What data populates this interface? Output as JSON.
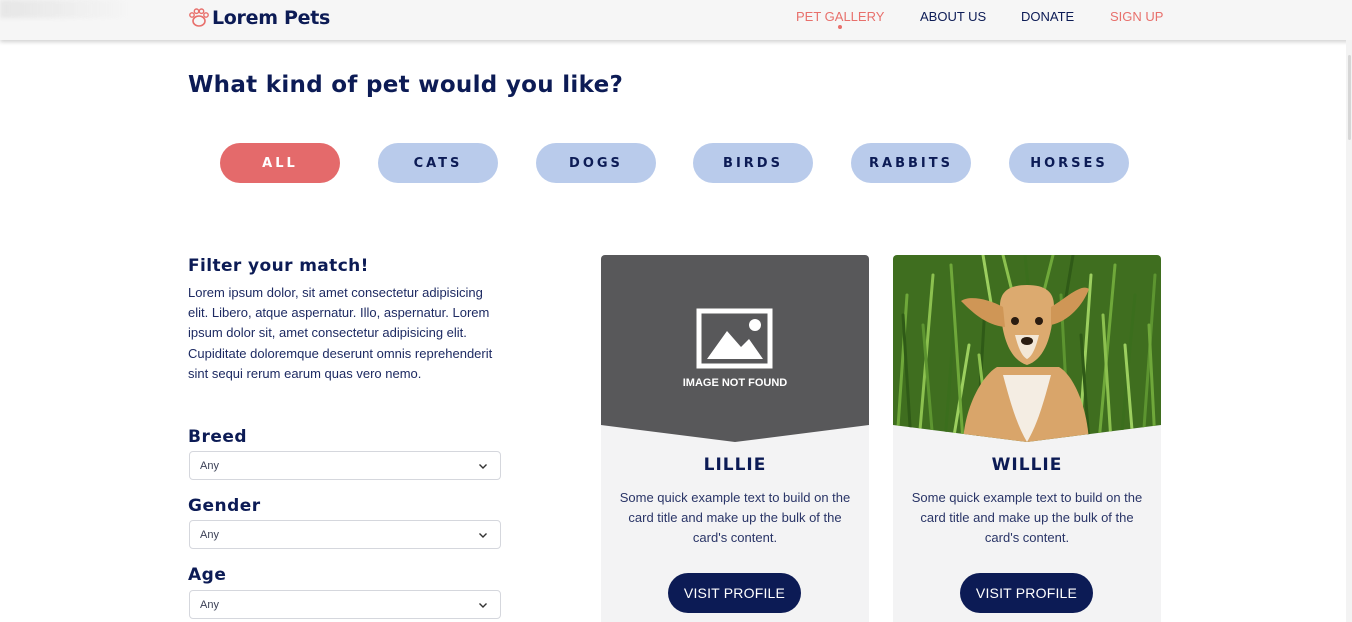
{
  "brand": {
    "name": "Lorem Pets",
    "icon": "paw-icon"
  },
  "nav": {
    "gallery": "PET GALLERY",
    "about": "ABOUT US",
    "donate": "DONATE",
    "signup": "SIGN UP"
  },
  "heading": "What kind of pet would you like?",
  "categories": [
    {
      "label": "ALL",
      "active": true
    },
    {
      "label": "CATS",
      "active": false
    },
    {
      "label": "DOGS",
      "active": false
    },
    {
      "label": "BIRDS",
      "active": false
    },
    {
      "label": "RABBITS",
      "active": false
    },
    {
      "label": "HORSES",
      "active": false
    }
  ],
  "filter": {
    "title": "Filter your match!",
    "description": "Lorem ipsum dolor, sit amet consectetur adipisicing elit. Libero, atque aspernatur. Illo, aspernatur. Lorem ipsum dolor sit, amet consectetur adipisicing elit. Cupiditate doloremque deserunt omnis reprehenderit sint sequi rerum earum quas vero nemo.",
    "fields": [
      {
        "label": "Breed",
        "value": "Any"
      },
      {
        "label": "Gender",
        "value": "Any"
      },
      {
        "label": "Age",
        "value": "Any"
      }
    ]
  },
  "cards": [
    {
      "name": "LILLIE",
      "image_placeholder": "IMAGE NOT FOUND",
      "text": "Some quick example text to build on the card title and make up the bulk of the card's content.",
      "button": "VISIT PROFILE"
    },
    {
      "name": "WILLIE",
      "text": "Some quick example text to build on the card title and make up the bulk of the card's content.",
      "button": "VISIT PROFILE"
    }
  ],
  "colors": {
    "navy": "#0c1b55",
    "coral": "#e46a6b",
    "pill": "#b9cbeb",
    "card_bg": "#f3f3f4",
    "placeholder_bg": "#58585a"
  }
}
